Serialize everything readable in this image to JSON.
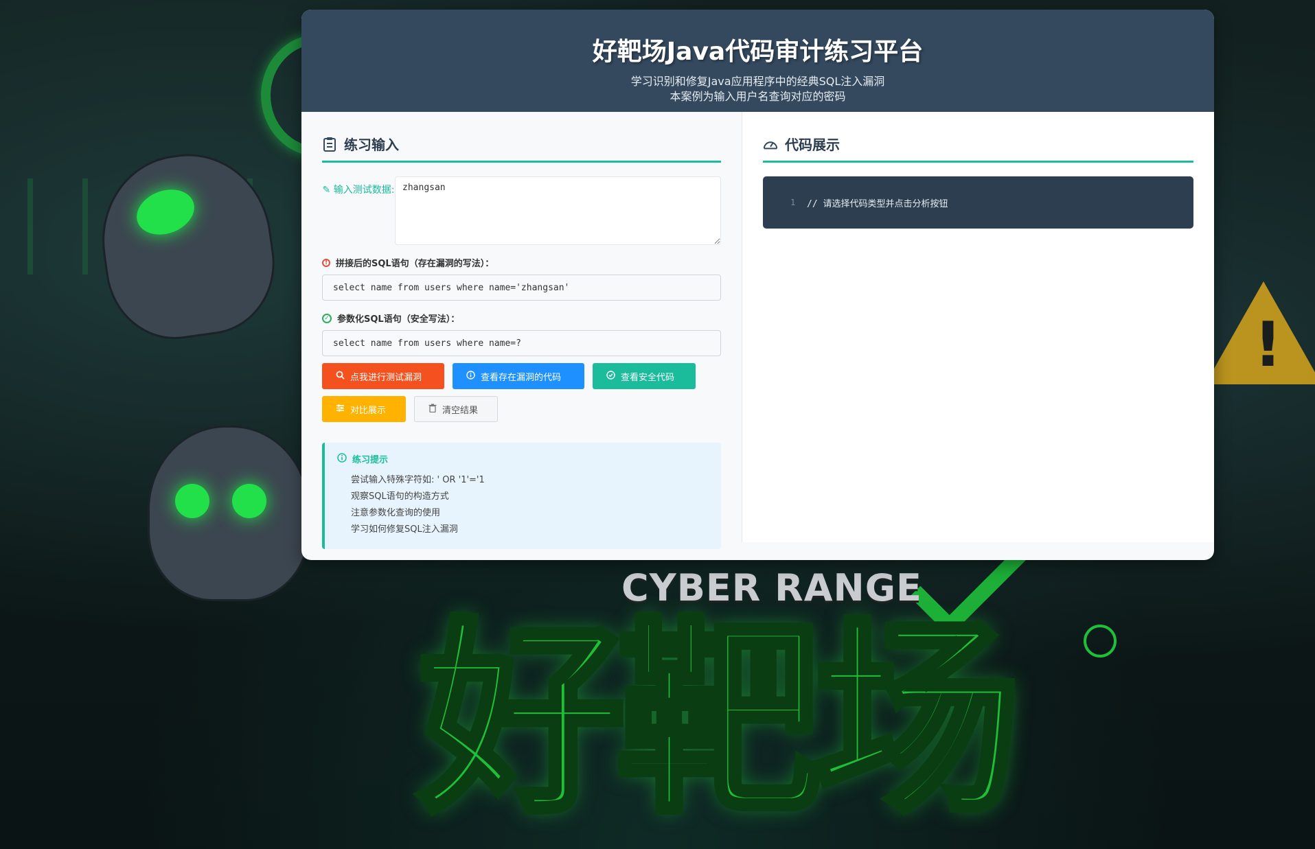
{
  "header": {
    "title": "好靶场Java代码审计练习平台",
    "subtitle_line1": "学习识别和修复Java应用程序中的经典SQL注入漏洞",
    "subtitle_line2": "本案例为输入用户名查询对应的密码"
  },
  "practice": {
    "section_title": "练习输入",
    "input_label": "输入测试数据:",
    "input_value": "zhangsan",
    "vuln_sql_label": "拼接后的SQL语句（存在漏洞的写法）：",
    "vuln_sql_value": "select name from users where name='zhangsan'",
    "safe_sql_label": "参数化SQL语句（安全写法）：",
    "safe_sql_value": "select name from users where name=?"
  },
  "buttons": {
    "test_vuln": "点我进行测试漏洞",
    "view_vuln_code": "查看存在漏洞的代码",
    "view_safe_code": "查看安全代码",
    "compare": "对比展示",
    "clear": "清空结果"
  },
  "tips": {
    "title": "练习提示",
    "items": [
      "尝试输入特殊字符如: ' OR '1'='1",
      "观察SQL语句的构造方式",
      "注意参数化查询的使用",
      "学习如何修复SQL注入漏洞"
    ]
  },
  "code_panel": {
    "section_title": "代码展示",
    "line_number": "1",
    "placeholder_code": "// 请选择代码类型并点击分析按钮"
  },
  "background": {
    "banner_text": "CYBER RANGE",
    "logo_text": "好靶场"
  },
  "colors": {
    "header_bg": "#34495e",
    "accent": "#1abc9c",
    "btn_red": "#f4511e",
    "btn_blue": "#1e90ff",
    "btn_teal": "#1abc9c",
    "btn_yellow": "#ffb300",
    "code_bg": "#2c3e50"
  }
}
